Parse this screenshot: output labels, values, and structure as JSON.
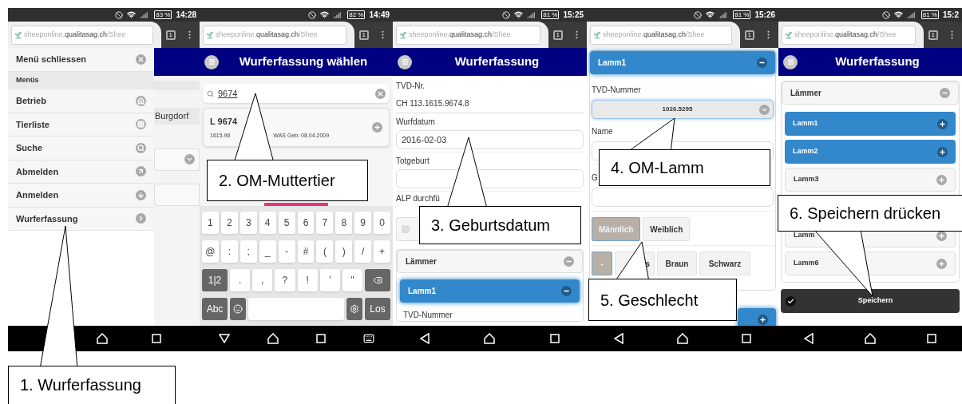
{
  "phones": [
    {
      "status": {
        "battery": "83 %",
        "time": "14:28"
      },
      "url": "sheeponline.**qualitasag.ch**/Shee",
      "tab_count": "1",
      "nav": [
        {
          "kind": "home"
        },
        {
          "kind": "recent"
        }
      ],
      "screen": {
        "kind": "menu",
        "close_label": "Menü schliessen",
        "section": "Menüs",
        "items": [
          {
            "label": "Betrieb"
          },
          {
            "label": "Tierliste"
          },
          {
            "label": "Suche"
          },
          {
            "label": "Abmelden"
          },
          {
            "label": "Anmelden"
          },
          {
            "label": "Wurferfassung"
          }
        ],
        "background_text": "Burgdorf"
      }
    },
    {
      "status": {
        "battery": "82 %",
        "time": "14:49"
      },
      "url": "sheeponline.**qualitasag.ch**/Shee",
      "tab_count": "1",
      "nav": [
        {
          "kind": "hide"
        },
        {
          "kind": "home"
        },
        {
          "kind": "recent"
        },
        {
          "kind": "keyboard"
        }
      ],
      "screen": {
        "kind": "search",
        "title": "Wurferfassung wählen",
        "search": {
          "value": "9674"
        },
        "results": [
          {
            "title": "L 9674",
            "detail_1": "1615.96",
            "detail_2": "WAS Geb: 08.04.2009"
          }
        ],
        "keyboard": [
          [
            {
              "kind": "char",
              "label": "1"
            },
            {
              "kind": "char",
              "label": "2"
            },
            {
              "kind": "char",
              "label": "3"
            },
            {
              "kind": "char",
              "label": "4"
            },
            {
              "kind": "char",
              "label": "5"
            },
            {
              "kind": "char",
              "label": "6"
            },
            {
              "kind": "char",
              "label": "7"
            },
            {
              "kind": "char",
              "label": "8"
            },
            {
              "kind": "char",
              "label": "9"
            },
            {
              "kind": "char",
              "label": "0"
            }
          ],
          [
            {
              "kind": "char",
              "label": "@"
            },
            {
              "kind": "char",
              "label": ":"
            },
            {
              "kind": "char",
              "label": ";"
            },
            {
              "kind": "char",
              "label": "_"
            },
            {
              "kind": "char",
              "label": "-"
            },
            {
              "kind": "char",
              "label": "#"
            },
            {
              "kind": "char",
              "label": "("
            },
            {
              "kind": "char",
              "label": ")"
            },
            {
              "kind": "char",
              "label": "/"
            },
            {
              "kind": "char",
              "label": "+"
            }
          ],
          [
            {
              "kind": "mod",
              "label": "1|2"
            },
            {
              "kind": "char",
              "label": "."
            },
            {
              "kind": "char",
              "label": ","
            },
            {
              "kind": "char",
              "label": "?"
            },
            {
              "kind": "char",
              "label": "!"
            },
            {
              "kind": "char",
              "label": "'"
            },
            {
              "kind": "char",
              "label": "\""
            },
            {
              "kind": "backspace"
            }
          ],
          [
            {
              "kind": "mod",
              "label": "Abc"
            },
            {
              "kind": "emoji"
            },
            {
              "kind": "space"
            },
            {
              "kind": "gear"
            },
            {
              "kind": "mod",
              "label": "Los"
            }
          ]
        ]
      }
    },
    {
      "status": {
        "battery": "81 %",
        "time": "15:25"
      },
      "url": "sheeponline.**qualitasag.ch**/Shee",
      "tab_count": "1",
      "nav": [
        {
          "kind": "back"
        },
        {
          "kind": "home"
        },
        {
          "kind": "recent"
        }
      ],
      "screen": {
        "kind": "form",
        "title": "Wurferfassung",
        "tvd_label": "TVD-Nr.",
        "tvd_value": "CH 113.1615.9674.8",
        "fields": [
          {
            "label": "Wurfdatum",
            "value": "2016-02-03"
          },
          {
            "label": "Totgeburt"
          }
        ],
        "alp": {
          "label": "ALP durchfü",
          "checked": false
        },
        "panel": {
          "title": "Lämmer",
          "expanded": true
        },
        "lamb": {
          "title": "Lamm1",
          "expanded": true,
          "field_label": "TVD-Nummer"
        }
      }
    },
    {
      "status": {
        "battery": "81 %",
        "time": "15:26"
      },
      "url": "sheeponline.**qualitasag.ch**/Shee",
      "tab_count": "1",
      "nav": [
        {
          "kind": "back"
        },
        {
          "kind": "home"
        },
        {
          "kind": "recent"
        }
      ],
      "screen": {
        "kind": "lamb_form",
        "lamb": {
          "title": "Lamm1",
          "expanded": true
        },
        "tvd": {
          "label": "TVD-Nummer",
          "value": "1026.5295"
        },
        "fields": [
          {
            "label": "Name"
          },
          {
            "label": "G"
          }
        ],
        "sex": [
          {
            "label": "Männlich",
            "selected": true
          },
          {
            "label": "Weiblich",
            "selected": false
          }
        ],
        "colors": [
          {
            "label": "-",
            "selected": true
          },
          {
            "label": "s",
            "selected": false
          },
          {
            "label": "Braun",
            "selected": false
          },
          {
            "label": "Schwarz",
            "selected": false
          }
        ],
        "next_lamb": {
          "expanded": false
        }
      }
    },
    {
      "status": {
        "battery": "81 %",
        "time": "15:2"
      },
      "url": "sheeponline.**qualitasag.ch**/Shee",
      "tab_count": "1",
      "nav": [
        {
          "kind": "back"
        },
        {
          "kind": "home"
        },
        {
          "kind": "recent"
        }
      ],
      "screen": {
        "kind": "lamb_list",
        "title": "Wurferfassung",
        "panel": {
          "title": "Lämmer",
          "expanded": true
        },
        "lambs": [
          {
            "label": "Lamm1",
            "active": true
          },
          {
            "label": "Lamm2",
            "active": true
          },
          {
            "label": "Lamm3",
            "active": false
          },
          {
            "label": "Lamm",
            "active": false
          },
          {
            "label": "Lamm6",
            "active": false
          }
        ],
        "save": "Speichern"
      }
    }
  ],
  "callouts": [
    {
      "label": "1. Wurferfassung"
    },
    {
      "label": "2. OM-Muttertier"
    },
    {
      "label": "3. Geburtsdatum"
    },
    {
      "label": "4. OM-Lamm"
    },
    {
      "label": "5. Geschlecht"
    },
    {
      "label": "6. Speichern drücken"
    }
  ]
}
